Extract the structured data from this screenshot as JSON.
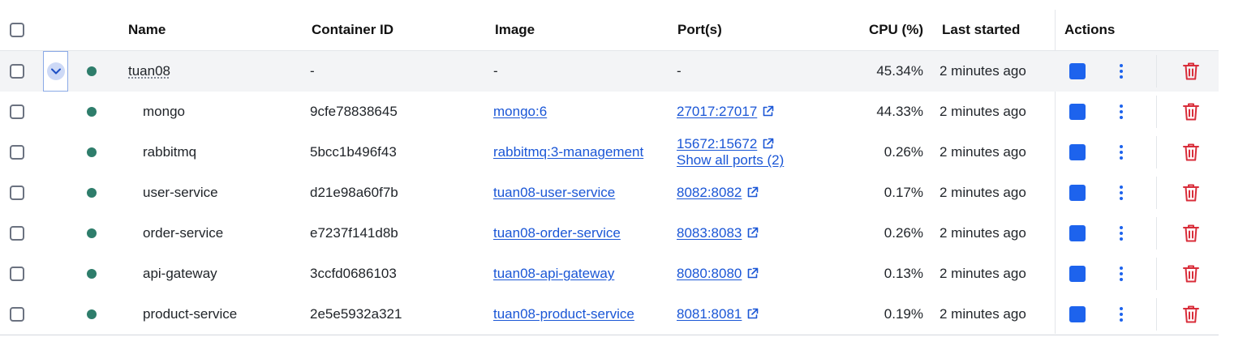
{
  "columns": {
    "name": "Name",
    "container_id": "Container ID",
    "image": "Image",
    "ports": "Port(s)",
    "cpu": "CPU (%)",
    "last_started": "Last started",
    "actions": "Actions"
  },
  "group": {
    "name": "tuan08",
    "container_id": "-",
    "image": "-",
    "ports": "-",
    "cpu": "45.34%",
    "last_started": "2 minutes ago"
  },
  "containers": [
    {
      "name": "mongo",
      "container_id": "9cfe78838645",
      "image": "mongo:6",
      "port": "27017:27017",
      "extra_ports": "",
      "cpu": "44.33%",
      "last_started": "2 minutes ago"
    },
    {
      "name": "rabbitmq",
      "container_id": "5bcc1b496f43",
      "image": "rabbitmq:3-management",
      "port": "15672:15672",
      "extra_ports": "Show all ports (2)",
      "cpu": "0.26%",
      "last_started": "2 minutes ago"
    },
    {
      "name": "user-service",
      "container_id": "d21e98a60f7b",
      "image": "tuan08-user-service",
      "port": "8082:8082",
      "extra_ports": "",
      "cpu": "0.17%",
      "last_started": "2 minutes ago"
    },
    {
      "name": "order-service",
      "container_id": "e7237f141d8b",
      "image": "tuan08-order-service",
      "port": "8083:8083",
      "extra_ports": "",
      "cpu": "0.26%",
      "last_started": "2 minutes ago"
    },
    {
      "name": "api-gateway",
      "container_id": "3ccfd0686103",
      "image": "tuan08-api-gateway",
      "port": "8080:8080",
      "extra_ports": "",
      "cpu": "0.13%",
      "last_started": "2 minutes ago"
    },
    {
      "name": "product-service",
      "container_id": "2e5e5932a321",
      "image": "tuan08-product-service",
      "port": "8081:8081",
      "extra_ports": "",
      "cpu": "0.19%",
      "last_started": "2 minutes ago"
    }
  ],
  "colors": {
    "status_running": "#2e7d6b",
    "link": "#1a56d6",
    "stop_button": "#1d63ed",
    "delete": "#d92d3a"
  },
  "icons": {
    "expander": "chevron-down-icon",
    "external": "external-link-icon",
    "stop": "stop-icon",
    "more": "kebab-menu-icon",
    "delete": "trash-icon"
  }
}
